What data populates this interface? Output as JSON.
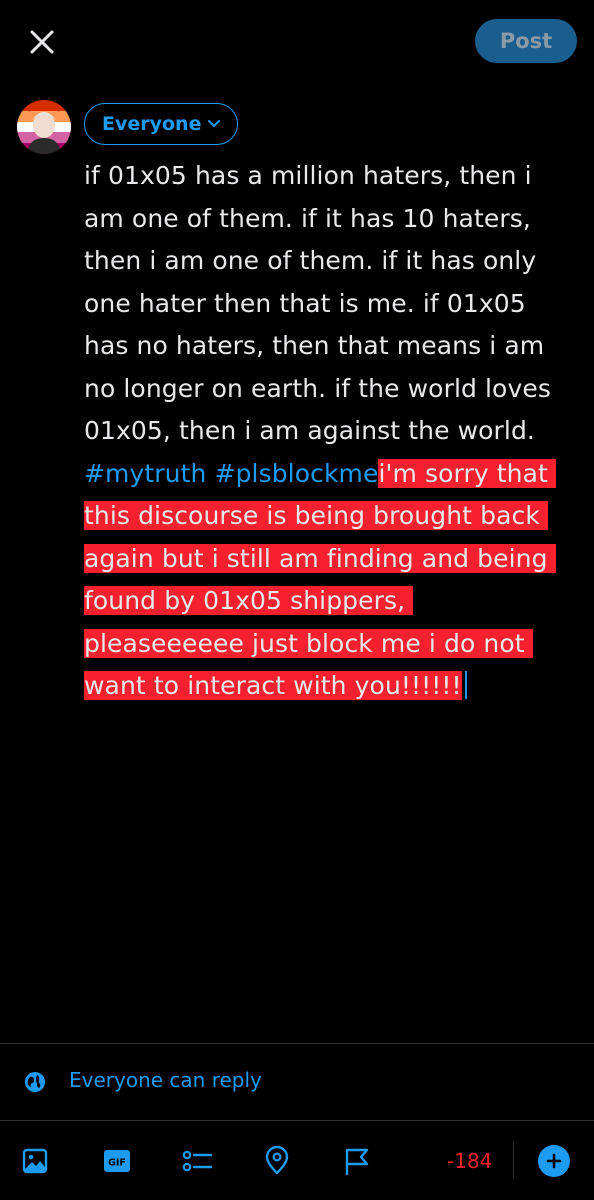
{
  "header": {
    "close_icon": "close-icon",
    "post_label": "Post"
  },
  "composer": {
    "audience_label": "Everyone",
    "text_normal": "if 01x05 has a million haters, then i am one of them. if it has 10 haters, then i am one of them. if it has only one hater then that is me. if 01x05 has no haters, then that means i am no longer on earth. if the world loves 01x05, then i am against the world. ",
    "hashtag_1": "#mytruth",
    "hashtag_2": "#plsblockme",
    "text_over_limit": "i'm sorry that this discourse is being brought back again but i still am finding and being found by 01x05 shippers, pleaseeeeee just block me i do not want to interact with you!!!!!!"
  },
  "reply_setting": {
    "icon": "globe-icon",
    "label": "Everyone can reply"
  },
  "toolbar": {
    "icons": [
      "image-icon",
      "gif-icon",
      "poll-icon",
      "location-icon",
      "flag-icon"
    ],
    "gif_text": "GIF",
    "char_counter": "-184",
    "add_icon": "plus-icon"
  },
  "colors": {
    "accent": "#1d9bf0",
    "over_limit_highlight": "#f6202e",
    "post_button_disabled": "#1a5d8f",
    "counter_negative": "#f4212e",
    "background": "#000000"
  }
}
